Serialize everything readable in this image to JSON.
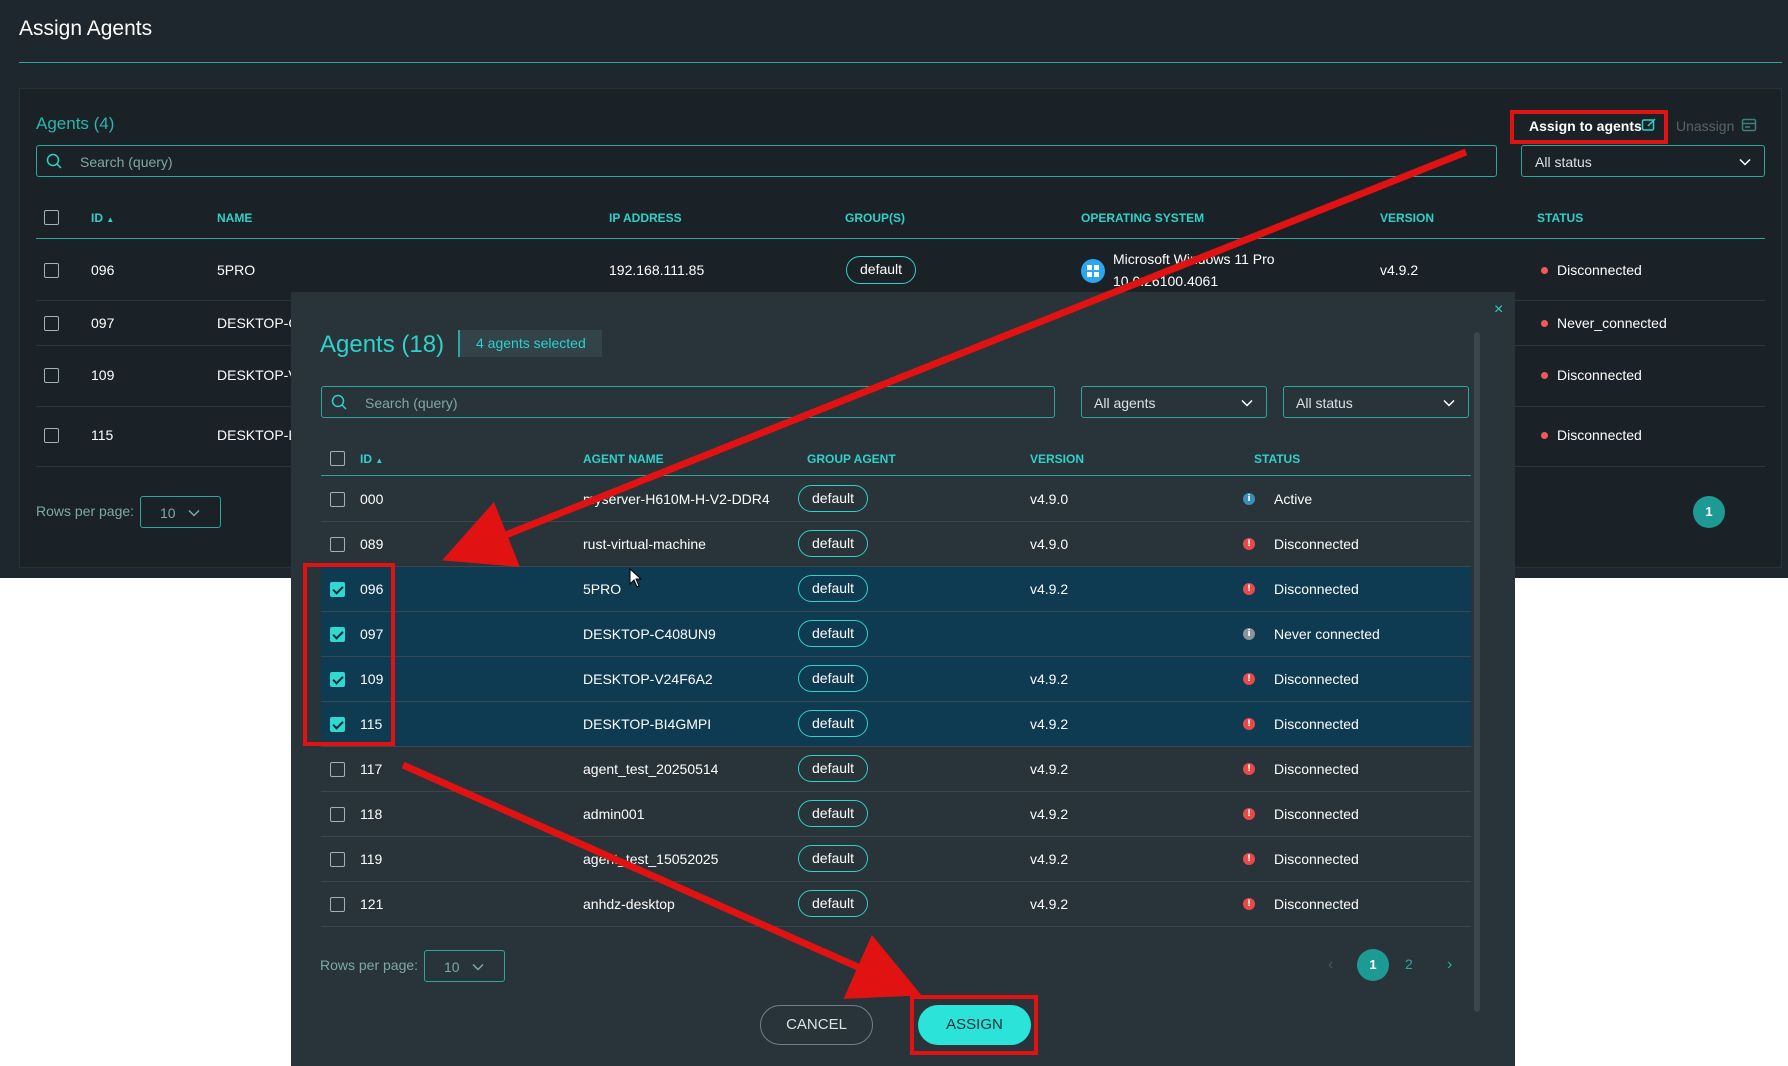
{
  "page": {
    "title": "Assign Agents",
    "panel": {
      "agents_title": "Agents (4)",
      "search_placeholder": "Search (query)",
      "status_filter": "All status",
      "assign_button": "Assign to agents",
      "unassign_button": "Unassign",
      "columns": [
        "ID",
        "NAME",
        "IP ADDRESS",
        "GROUP(S)",
        "OPERATING SYSTEM",
        "VERSION",
        "STATUS"
      ],
      "rows": [
        {
          "id": "096",
          "name": "5PRO",
          "ip": "192.168.111.85",
          "group": "default",
          "os_line1": "Microsoft Windows 11 Pro",
          "os_line2": "10.0.26100.4061",
          "version": "v4.9.2",
          "status": "Disconnected"
        },
        {
          "id": "097",
          "name": "DESKTOP-C",
          "status": "Never_connected"
        },
        {
          "id": "109",
          "name": "DESKTOP-V",
          "status": "Disconnected"
        },
        {
          "id": "115",
          "name": "DESKTOP-BI",
          "status": "Disconnected"
        }
      ],
      "rows_per_page_label": "Rows per page:",
      "rows_per_page": "10",
      "current_page": "1"
    }
  },
  "modal": {
    "title": "Agents (18)",
    "selected_badge": "4 agents selected",
    "search_placeholder": "Search (query)",
    "agents_filter": "All agents",
    "status_filter": "All status",
    "close_icon": "×",
    "columns": [
      "ID",
      "AGENT NAME",
      "GROUP AGENT",
      "VERSION",
      "STATUS"
    ],
    "rows": [
      {
        "id": "000",
        "name": "myserver-H610M-H-V2-DDR4",
        "group": "default",
        "version": "v4.9.0",
        "status": "Active",
        "status_kind": "active",
        "checked": false
      },
      {
        "id": "089",
        "name": "rust-virtual-machine",
        "group": "default",
        "version": "v4.9.0",
        "status": "Disconnected",
        "status_kind": "disc",
        "checked": false
      },
      {
        "id": "096",
        "name": "5PRO",
        "group": "default",
        "version": "v4.9.2",
        "status": "Disconnected",
        "status_kind": "disc",
        "checked": true
      },
      {
        "id": "097",
        "name": "DESKTOP-C408UN9",
        "group": "default",
        "version": "",
        "status": "Never connected",
        "status_kind": "never",
        "checked": true
      },
      {
        "id": "109",
        "name": "DESKTOP-V24F6A2",
        "group": "default",
        "version": "v4.9.2",
        "status": "Disconnected",
        "status_kind": "disc",
        "checked": true
      },
      {
        "id": "115",
        "name": "DESKTOP-BI4GMPI",
        "group": "default",
        "version": "v4.9.2",
        "status": "Disconnected",
        "status_kind": "disc",
        "checked": true
      },
      {
        "id": "117",
        "name": "agent_test_20250514",
        "group": "default",
        "version": "v4.9.2",
        "status": "Disconnected",
        "status_kind": "disc",
        "checked": false
      },
      {
        "id": "118",
        "name": "admin001",
        "group": "default",
        "version": "v4.9.2",
        "status": "Disconnected",
        "status_kind": "disc",
        "checked": false
      },
      {
        "id": "119",
        "name": "agent_test_15052025",
        "group": "default",
        "version": "v4.9.2",
        "status": "Disconnected",
        "status_kind": "disc",
        "checked": false
      },
      {
        "id": "121",
        "name": "anhdz-desktop",
        "group": "default",
        "version": "v4.9.2",
        "status": "Disconnected",
        "status_kind": "disc",
        "checked": false
      }
    ],
    "rows_per_page_label": "Rows per page:",
    "rows_per_page": "10",
    "pages": [
      "1",
      "2"
    ],
    "cancel_label": "CANCEL",
    "assign_label": "ASSIGN"
  },
  "colors": {
    "accent": "#2fd1c9",
    "annotation_red": "#e01212",
    "selected_row": "#0e3a52",
    "status_disconnected": "#e84a4a"
  }
}
